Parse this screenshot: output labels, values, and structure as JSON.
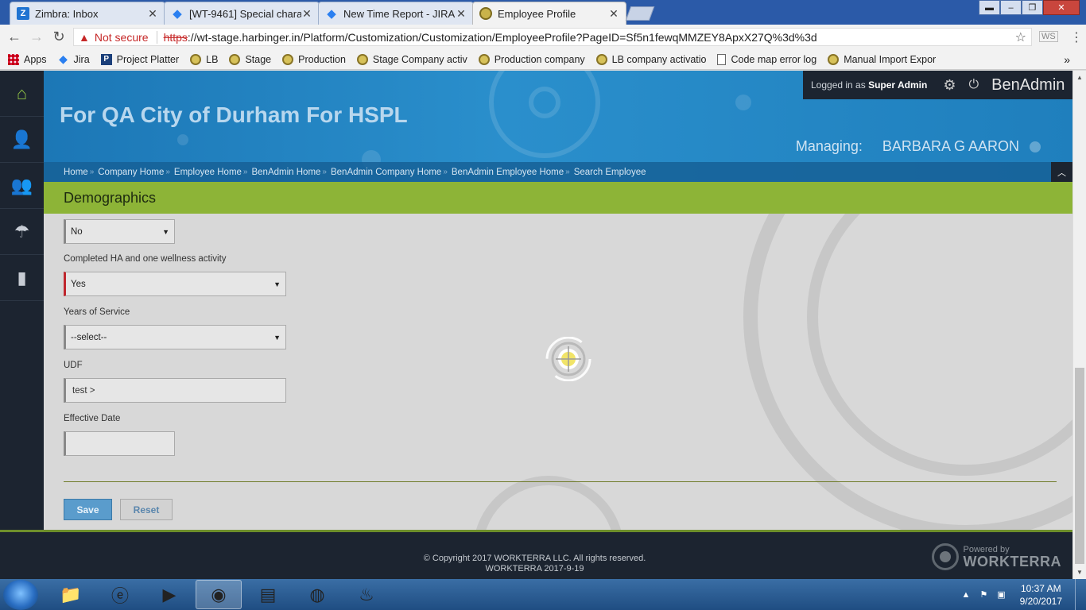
{
  "browser": {
    "tabs": [
      {
        "title": "Zimbra: Inbox",
        "icon": "zimbra-icon"
      },
      {
        "title": "[WT-9461] Special chara",
        "icon": "jira-icon"
      },
      {
        "title": "New Time Report - JIRA",
        "icon": "jira-icon"
      },
      {
        "title": "Employee Profile",
        "icon": "workterra-icon",
        "active": true
      }
    ],
    "security_label": "Not secure",
    "url_scheme": "https",
    "url_rest": "://wt-stage.harbinger.in/Platform/Customization/Customization/EmployeeProfile?PageID=Sf5n1fewqMMZEY8ApxX27Q%3d%3d",
    "extension_label": "WS",
    "bookmarks": [
      {
        "label": "Apps",
        "icon": "apps-grid-icon"
      },
      {
        "label": "Jira",
        "icon": "jira-icon"
      },
      {
        "label": "Project Platter",
        "icon": "project-p-icon"
      },
      {
        "label": "LB",
        "icon": "workterra-icon"
      },
      {
        "label": "Stage",
        "icon": "workterra-icon"
      },
      {
        "label": "Production",
        "icon": "workterra-icon"
      },
      {
        "label": "Stage Company activ",
        "icon": "workterra-icon"
      },
      {
        "label": "Production company",
        "icon": "workterra-icon"
      },
      {
        "label": "LB company activatio",
        "icon": "workterra-icon"
      },
      {
        "label": "Code map error log",
        "icon": "document-icon"
      },
      {
        "label": "Manual Import Expor",
        "icon": "workterra-icon"
      }
    ]
  },
  "header": {
    "company_title": "For QA City of Durham For HSPL",
    "logged_in_prefix": "Logged in as",
    "logged_in_user": "Super Admin",
    "brand": "BenAdmin",
    "managing_label": "Managing:",
    "managing_name": "BARBARA G AARON"
  },
  "breadcrumb": [
    "Home",
    "Company Home",
    "Employee Home",
    "BenAdmin Home",
    "BenAdmin Company Home",
    "BenAdmin Employee Home",
    "Search Employee"
  ],
  "section": {
    "title": "Demographics"
  },
  "form": {
    "first_select_value": "No",
    "ha_label": "Completed HA and one wellness activity",
    "ha_value": "Yes",
    "years_label": "Years of Service",
    "years_value": "--select--",
    "udf_label": "UDF",
    "udf_value": "test >",
    "effective_label": "Effective Date",
    "effective_value": "",
    "save_label": "Save",
    "reset_label": "Reset"
  },
  "footer": {
    "copyright": "© Copyright 2017 WORKTERRA LLC. All rights reserved.",
    "version": "WORKTERRA 2017-9-19",
    "powered_by": "Powered by",
    "powered_brand": "WORKTERRA"
  },
  "taskbar": {
    "time": "10:37 AM",
    "date": "9/20/2017"
  }
}
